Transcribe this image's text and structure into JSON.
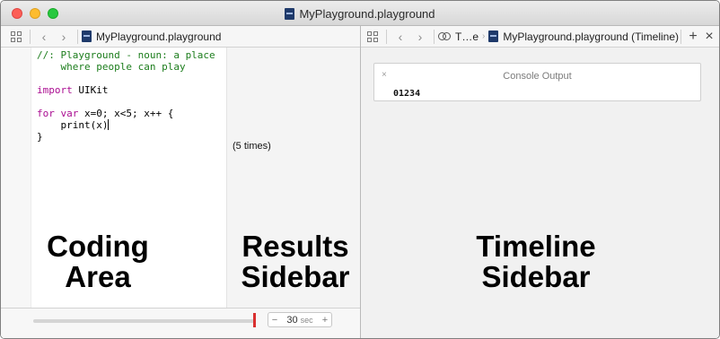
{
  "window": {
    "title": "MyPlayground.playground",
    "file_icon": "playground-file-icon"
  },
  "left_editor": {
    "jumpbar": {
      "back": "‹",
      "forward": "›",
      "file_label": "MyPlayground.playground"
    },
    "code_lines": [
      {
        "text": "//: Playground - noun: a place",
        "kind": "comment"
      },
      {
        "text": "    where people can play",
        "kind": "comment"
      },
      {
        "text": "",
        "kind": "plain"
      },
      {
        "text": "import UIKit",
        "kind": "import"
      },
      {
        "text": "",
        "kind": "plain"
      },
      {
        "text": "for var x=0; x<5; x++ {",
        "kind": "for"
      },
      {
        "text": "    print(x)",
        "kind": "plain"
      },
      {
        "text": "}",
        "kind": "plain"
      }
    ],
    "result": "(5 times)",
    "timeline_duration": {
      "minus": "−",
      "value": "30",
      "unit": "sec",
      "plus": "+"
    }
  },
  "right_editor": {
    "jumpbar": {
      "back": "‹",
      "forward": "›",
      "timeline_crumb": "T…e",
      "file_label": "MyPlayground.playground (Timeline)",
      "add": "+",
      "close": "×"
    },
    "console": {
      "close": "×",
      "title": "Console Output",
      "output": "01234"
    }
  },
  "annotations": {
    "coding_area": [
      "Coding",
      "Area"
    ],
    "results_sidebar": [
      "Results",
      "Sidebar"
    ],
    "timeline_sidebar": [
      "Timeline",
      "Sidebar"
    ]
  },
  "colors": {
    "comment": "#1c7d1c",
    "keyword": "#aa0d91",
    "slider_thumb": "#d93030",
    "close_light": "#fc5f57",
    "minimize_light": "#fdbc2e",
    "zoom_light": "#28c840"
  }
}
